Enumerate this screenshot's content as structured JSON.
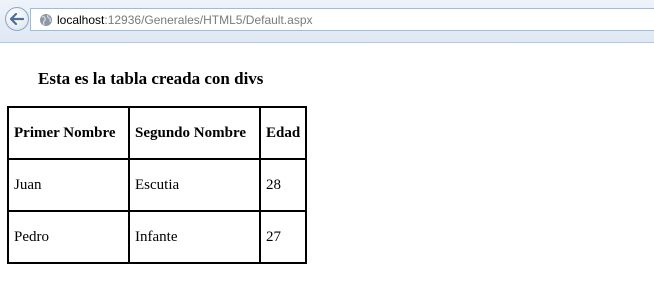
{
  "browser": {
    "url_host": "localhost",
    "url_path": ":12936/Generales/HTML5/Default.aspx",
    "back_icon": "back-arrow-icon",
    "site_icon": "globe-icon"
  },
  "page": {
    "heading": "Esta es la tabla creada con divs",
    "table": {
      "headers": [
        "Primer Nombre",
        "Segundo Nombre",
        "Edad"
      ],
      "rows": [
        [
          "Juan",
          "Escutia",
          "28"
        ],
        [
          "Pedro",
          "Infante",
          "27"
        ]
      ]
    }
  }
}
